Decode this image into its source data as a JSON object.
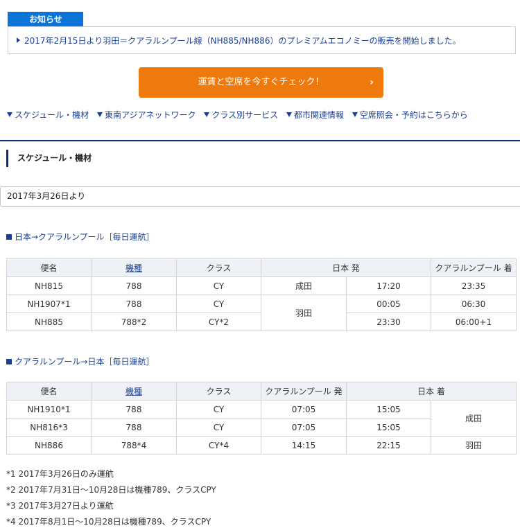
{
  "notice": {
    "tab_label": "お知らせ",
    "text": "2017年2月15日より羽田＝クアラルンプール線（NH885/NH886）のプレミアムエコノミーの販売を開始しました。"
  },
  "cta": {
    "label": "運賃と空席を今すぐチェック！",
    "chevron": "›"
  },
  "anchors": [
    "スケジュール・機材",
    "東南アジアネットワーク",
    "クラス別サービス",
    "都市関連情報",
    "空席照会・予約はこちらから"
  ],
  "section": {
    "title": "スケジュール・機材"
  },
  "effective_date": "2017年3月26日より",
  "outbound": {
    "title": "日本→クアラルンプール［毎日運航］",
    "headers": {
      "flight": "便名",
      "aircraft": "機種",
      "class": "クラス",
      "depart": "日本 発",
      "arrive": "クアラルンプール 着"
    },
    "rows": [
      {
        "flight": "NH815",
        "aircraft": "788",
        "class": "CY",
        "airport": "成田",
        "dep": "17:20",
        "arr": "23:35"
      },
      {
        "flight": "NH1907*1",
        "aircraft": "788",
        "class": "CY",
        "airport": "羽田",
        "dep": "00:05",
        "arr": "06:30"
      },
      {
        "flight": "NH885",
        "aircraft": "788*2",
        "class": "CY*2",
        "airport": "",
        "dep": "23:30",
        "arr": "06:00+1"
      }
    ]
  },
  "inbound": {
    "title": "クアラルンプール→日本［毎日運航］",
    "headers": {
      "flight": "便名",
      "aircraft": "機種",
      "class": "クラス",
      "depart": "クアラルンプール 発",
      "arrive": "日本 着"
    },
    "rows": [
      {
        "flight": "NH1910*1",
        "aircraft": "788",
        "class": "CY",
        "dep": "07:05",
        "arr": "15:05",
        "airport": "成田"
      },
      {
        "flight": "NH816*3",
        "aircraft": "788",
        "class": "CY",
        "dep": "07:05",
        "arr": "15:05",
        "airport": ""
      },
      {
        "flight": "NH886",
        "aircraft": "788*4",
        "class": "CY*4",
        "dep": "14:15",
        "arr": "22:15",
        "airport": "羽田"
      }
    ]
  },
  "notes": [
    "*1 2017年3月26日のみ運航",
    "*2 2017年7月31日～10月28日は機種789、クラスCPY",
    "*3 2017年3月27日より運航",
    "*4 2017年8月1日～10月28日は機種789、クラスCPY"
  ],
  "colors": {
    "brand_blue": "#0a74d9",
    "navy": "#0f2c70",
    "link": "#1c3f94",
    "cta_orange": "#ee7a0e",
    "table_header_bg": "#eef2f7"
  }
}
